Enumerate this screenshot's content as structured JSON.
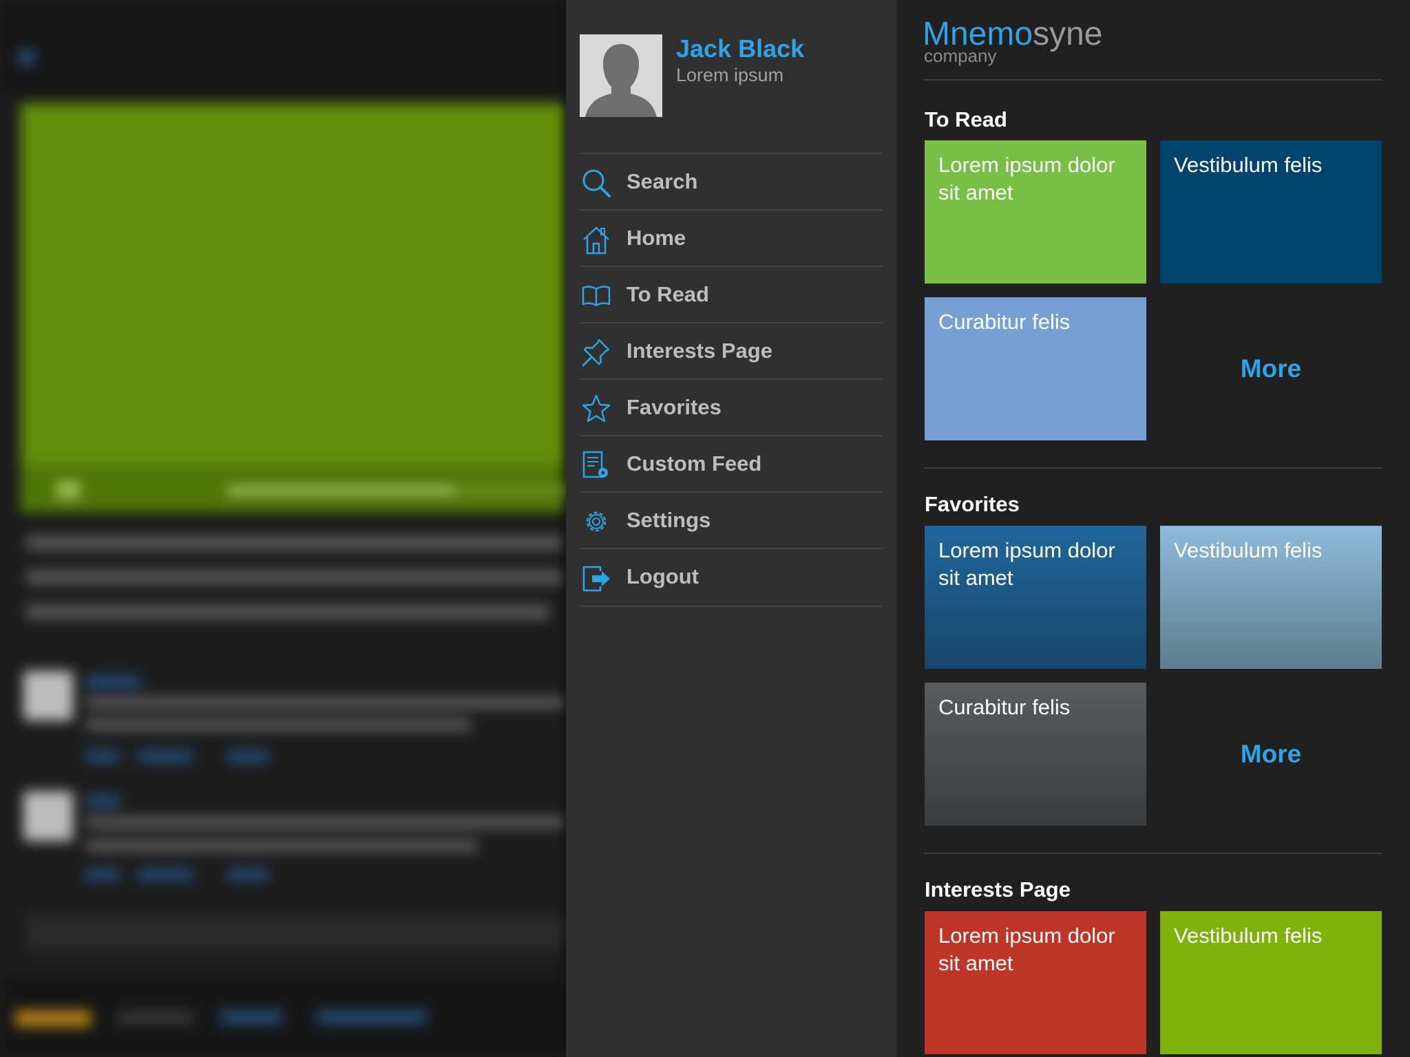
{
  "profile": {
    "name": "Jack Black",
    "subtitle": "Lorem ipsum"
  },
  "menu": [
    {
      "label": "Search",
      "icon": "search-icon"
    },
    {
      "label": "Home",
      "icon": "home-icon"
    },
    {
      "label": "To Read",
      "icon": "book-icon"
    },
    {
      "label": "Interests Page",
      "icon": "pin-icon"
    },
    {
      "label": "Favorites",
      "icon": "star-icon"
    },
    {
      "label": "Custom Feed",
      "icon": "feed-settings-icon"
    },
    {
      "label": "Settings",
      "icon": "gear-icon"
    },
    {
      "label": "Logout",
      "icon": "logout-icon"
    }
  ],
  "brand": {
    "name_part1": "Mnemo",
    "name_part2": "syne",
    "subtitle": "company"
  },
  "sections": [
    {
      "title": "To Read",
      "tiles": [
        "Lorem ipsum dolor sit amet",
        "Vestibulum felis",
        "Curabitur felis"
      ],
      "more": "More"
    },
    {
      "title": "Favorites",
      "tiles": [
        "Lorem ipsum dolor sit amet",
        "Vestibulum felis",
        "Curabitur felis"
      ],
      "more": "More"
    },
    {
      "title": "Interests Page",
      "tiles": [
        "Lorem ipsum dolor sit amet",
        "Vestibulum felis"
      ]
    }
  ],
  "colors": {
    "accent": "#2ea3e6",
    "to_read_tiles": [
      "#78bf46",
      "#00446d",
      "#769fd4"
    ],
    "favorites_tiles": [
      "#1d5f90",
      "#7fa8c4",
      "#4f5053"
    ],
    "interests_tiles": [
      "#bf3628",
      "#7fb10b"
    ]
  }
}
